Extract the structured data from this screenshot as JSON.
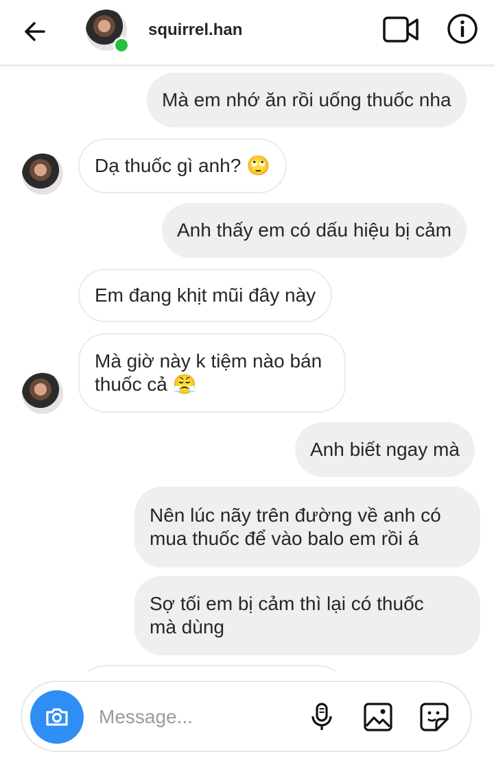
{
  "header": {
    "back_icon": "arrow-left-icon",
    "username": "squirrel.han",
    "online": true,
    "video_icon": "video-camera-icon",
    "info_icon": "info-icon",
    "online_color": "#25c13c"
  },
  "messages": [
    {
      "side": "out",
      "text": "Mà em nhớ ăn rồi uống thuốc nha"
    },
    {
      "side": "in",
      "text": "Dạ thuốc gì anh?",
      "emoji": "🙄",
      "avatar": true
    },
    {
      "side": "out",
      "text": "Anh thấy em có dấu hiệu bị cảm"
    },
    {
      "side": "in",
      "text": "Em đang khịt mũi đây này"
    },
    {
      "side": "in",
      "lines": [
        "Mà giờ này k tiệm nào bán",
        "thuốc cả"
      ],
      "emoji": "😤",
      "avatar": true
    },
    {
      "side": "out",
      "text": "Anh biết ngay mà"
    },
    {
      "side": "out",
      "lines": [
        "Nên lúc nãy trên đường về anh có",
        "mua thuốc để vào balo em rồi á"
      ]
    },
    {
      "side": "out",
      "lines": [
        "Sợ tối em bị cảm thì lại có thuốc",
        "mà dùng"
      ]
    }
  ],
  "composer": {
    "placeholder": "Message...",
    "camera_icon": "camera-icon",
    "mic_icon": "microphone-icon",
    "gallery_icon": "image-icon",
    "sticker_icon": "sticker-icon",
    "accent": "#2f8ef3"
  },
  "colors": {
    "outgoing_bubble": "#efefef",
    "incoming_border": "#eaeaea",
    "text": "#262626"
  }
}
